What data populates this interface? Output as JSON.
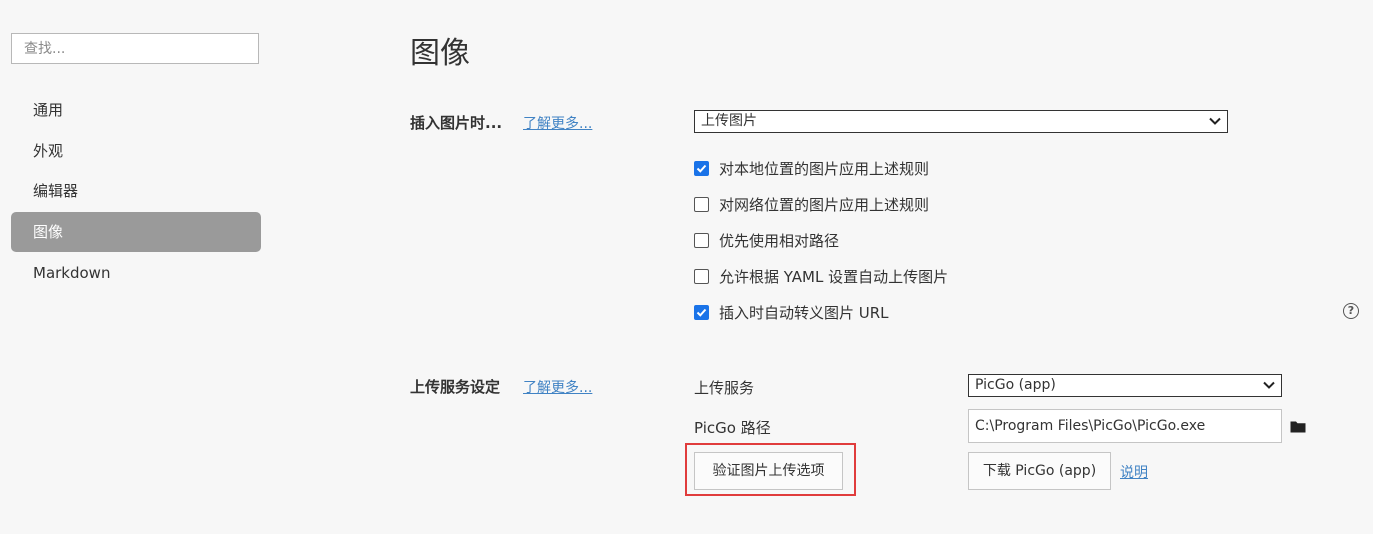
{
  "sidebar": {
    "search_placeholder": "查找...",
    "items": [
      {
        "label": "通用"
      },
      {
        "label": "外观"
      },
      {
        "label": "编辑器"
      },
      {
        "label": "图像",
        "active": true
      },
      {
        "label": "Markdown"
      }
    ]
  },
  "main": {
    "title": "图像",
    "insert_section": {
      "label": "插入图片时...",
      "learn_more": "了解更多...",
      "select_value": "上传图片",
      "options": [
        {
          "label": "对本地位置的图片应用上述规则",
          "checked": true
        },
        {
          "label": "对网络位置的图片应用上述规则",
          "checked": false
        },
        {
          "label": "优先使用相对路径",
          "checked": false
        },
        {
          "label": "允许根据 YAML 设置自动上传图片",
          "checked": false
        },
        {
          "label": "插入时自动转义图片 URL",
          "checked": true
        }
      ],
      "help_icon": "?"
    },
    "upload_section": {
      "label": "上传服务设定",
      "learn_more": "了解更多...",
      "service_label": "上传服务",
      "service_value": "PicGo (app)",
      "path_label": "PicGo 路径",
      "path_value": "C:\\Program Files\\PicGo\\PicGo.exe",
      "verify_button": "验证图片上传选项",
      "download_button": "下载 PicGo (app)",
      "explain_link": "说明"
    }
  },
  "colors": {
    "accent": "#1a73e8",
    "link": "#4183c4",
    "active_nav": "#9a9a9a",
    "highlight": "#e03c3c"
  }
}
